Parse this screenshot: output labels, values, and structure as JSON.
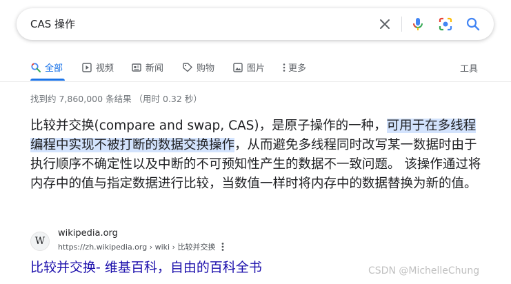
{
  "search": {
    "query": "CAS 操作"
  },
  "tabs": [
    {
      "label": "全部",
      "icon": "search-icon",
      "active": true
    },
    {
      "label": "视频",
      "icon": "play-icon"
    },
    {
      "label": "新闻",
      "icon": "news-icon"
    },
    {
      "label": "购物",
      "icon": "tag-icon"
    },
    {
      "label": "图片",
      "icon": "image-icon"
    },
    {
      "label": "更多",
      "icon": "more-vert-icon"
    }
  ],
  "tools_label": "工具",
  "stats": "找到约 7,860,000 条结果 （用时 0.32 秒）",
  "snippet": {
    "part1": "比较并交换(compare and swap, CAS)，是原子操作的一种，",
    "highlight": "可用于在多线程编程中实现不被打断的数据交换操作",
    "part2": "，从而避免多线程同时改写某一数据时由于执行顺序不确定性以及中断的不可预知性产生的数据不一致问题。 该操作通过将内存中的值与指定数据进行比较，当数值一样时将内存中的数据替换为新的值。"
  },
  "result": {
    "favicon_letter": "W",
    "site_name": "wikipedia.org",
    "url": "https://zh.wikipedia.org › wiki › 比较并交换",
    "title": "比较并交换- 维基百科，自由的百科全书"
  },
  "watermark": "CSDN @MichelleChung",
  "colors": {
    "accent": "#1a73e8",
    "link": "#1a0dab",
    "highlight": "#d3e3fd"
  }
}
